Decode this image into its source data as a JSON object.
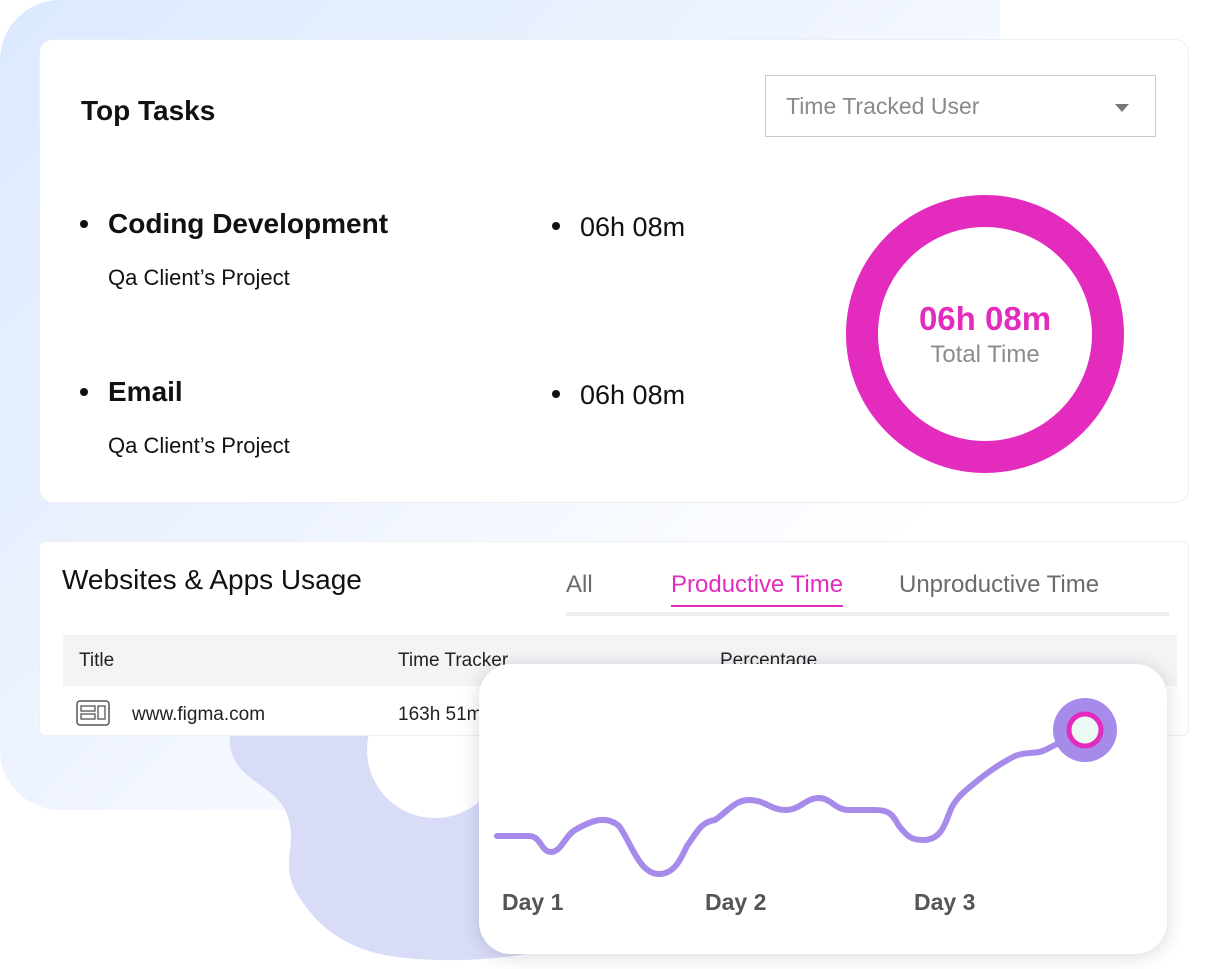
{
  "top_tasks": {
    "title": "Top Tasks",
    "filter": {
      "selected": "Time Tracked User",
      "icon": "caret-down-icon"
    },
    "items": [
      {
        "name": "Coding Development",
        "project": "Qa Client’s Project",
        "time": "06h 08m"
      },
      {
        "name": "Email",
        "project": "Qa Client’s Project",
        "time": "06h 08m"
      }
    ],
    "total": {
      "value": "06h 08m",
      "label": "Total Time"
    }
  },
  "usage": {
    "title": "Websites & Apps Usage",
    "tabs": [
      {
        "label": "All",
        "active": false
      },
      {
        "label": "Productive Time",
        "active": true
      },
      {
        "label": "Unproductive Time",
        "active": false
      }
    ],
    "columns": [
      "Title",
      "Time Tracker",
      "Percentage"
    ],
    "rows": [
      {
        "icon": "website-icon",
        "title": "www.figma.com",
        "time": "163h 51m"
      }
    ]
  },
  "trend": {
    "days": [
      "Day 1",
      "Day 2",
      "Day 3"
    ],
    "line_color": "#a78bea",
    "marker_color": "#e32cbe"
  },
  "colors": {
    "accent": "#e32cbe",
    "line": "#a78bea",
    "gear": "#d8dcf7",
    "background_tint": "#dbe9ff"
  }
}
